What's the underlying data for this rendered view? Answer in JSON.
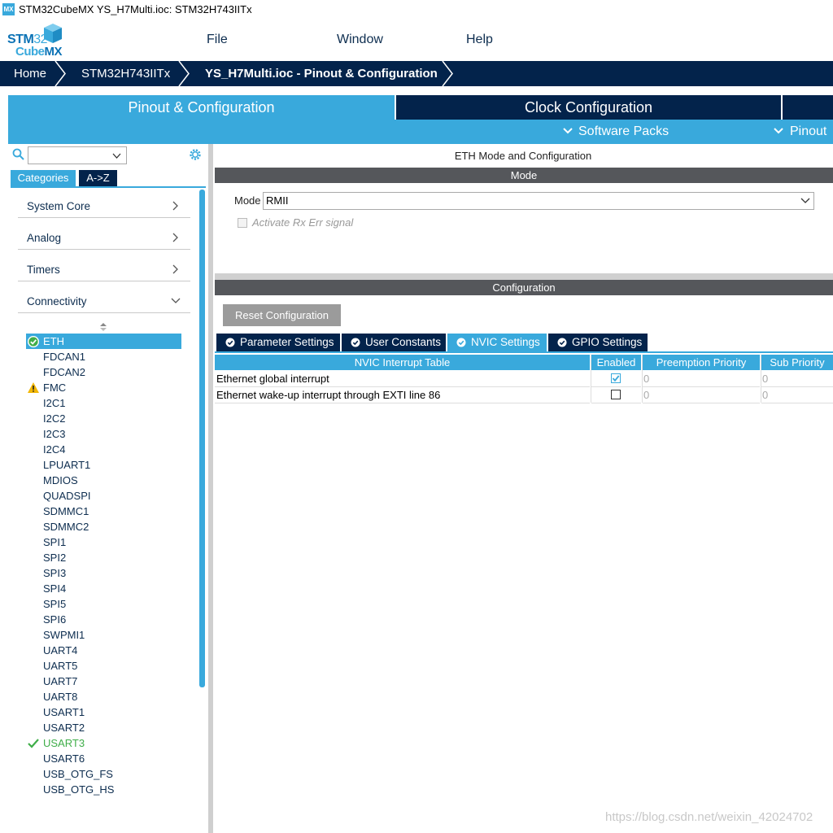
{
  "window": {
    "app_icon": "MX",
    "title": "STM32CubeMX YS_H7Multi.ioc: STM32H743IITx"
  },
  "logo": {
    "stm": "STM",
    "stm_num": "32",
    "cube": "Cube",
    "mx": "MX"
  },
  "menu": {
    "file": "File",
    "window": "Window",
    "help": "Help"
  },
  "breadcrumb": {
    "home": "Home",
    "device": "STM32H743IITx",
    "project": "YS_H7Multi.ioc - Pinout & Configuration"
  },
  "top_tabs": {
    "pinout": "Pinout & Configuration",
    "clock": "Clock Configuration"
  },
  "sub_menu": {
    "software_packs": "Software Packs",
    "pinout": "Pinout"
  },
  "left": {
    "search_value": "",
    "tab_categories": "Categories",
    "tab_az": "A->Z",
    "categories": [
      "System Core",
      "Analog",
      "Timers",
      "Connectivity"
    ],
    "items": [
      {
        "label": "ETH",
        "state": "selected-ok"
      },
      {
        "label": "FDCAN1",
        "state": ""
      },
      {
        "label": "FDCAN2",
        "state": ""
      },
      {
        "label": "FMC",
        "state": "warning"
      },
      {
        "label": "I2C1",
        "state": ""
      },
      {
        "label": "I2C2",
        "state": ""
      },
      {
        "label": "I2C3",
        "state": ""
      },
      {
        "label": "I2C4",
        "state": ""
      },
      {
        "label": "LPUART1",
        "state": ""
      },
      {
        "label": "MDIOS",
        "state": ""
      },
      {
        "label": "QUADSPI",
        "state": ""
      },
      {
        "label": "SDMMC1",
        "state": ""
      },
      {
        "label": "SDMMC2",
        "state": ""
      },
      {
        "label": "SPI1",
        "state": ""
      },
      {
        "label": "SPI2",
        "state": ""
      },
      {
        "label": "SPI3",
        "state": ""
      },
      {
        "label": "SPI4",
        "state": ""
      },
      {
        "label": "SPI5",
        "state": ""
      },
      {
        "label": "SPI6",
        "state": ""
      },
      {
        "label": "SWPMI1",
        "state": ""
      },
      {
        "label": "UART4",
        "state": ""
      },
      {
        "label": "UART5",
        "state": ""
      },
      {
        "label": "UART7",
        "state": ""
      },
      {
        "label": "UART8",
        "state": ""
      },
      {
        "label": "USART1",
        "state": ""
      },
      {
        "label": "USART2",
        "state": ""
      },
      {
        "label": "USART3",
        "state": "ok"
      },
      {
        "label": "USART6",
        "state": ""
      },
      {
        "label": "USB_OTG_FS",
        "state": ""
      },
      {
        "label": "USB_OTG_HS",
        "state": ""
      }
    ]
  },
  "right": {
    "title": "ETH Mode and Configuration",
    "mode_header": "Mode",
    "mode_label": "Mode",
    "mode_value": "RMII",
    "rx_err_label": "Activate Rx Err signal",
    "config_header": "Configuration",
    "reset_button": "Reset Configuration",
    "tabs": [
      "Parameter Settings",
      "User Constants",
      "NVIC Settings",
      "GPIO Settings"
    ],
    "active_tab": "NVIC Settings",
    "table": {
      "headers": [
        "NVIC Interrupt Table",
        "Enabled",
        "Preemption Priority",
        "Sub Priority"
      ],
      "rows": [
        {
          "name": "Ethernet global interrupt",
          "enabled": true,
          "preemption": "0",
          "sub": "0"
        },
        {
          "name": "Ethernet wake-up interrupt through EXTI line 86",
          "enabled": false,
          "preemption": "0",
          "sub": "0"
        }
      ]
    }
  },
  "watermark": "https://blog.csdn.net/weixin_42024702",
  "colors": {
    "accent": "#39a9dc",
    "navy": "#03234b",
    "gray_header": "#55575b",
    "ok_green": "#3fae49",
    "warning": "#f2b705"
  }
}
